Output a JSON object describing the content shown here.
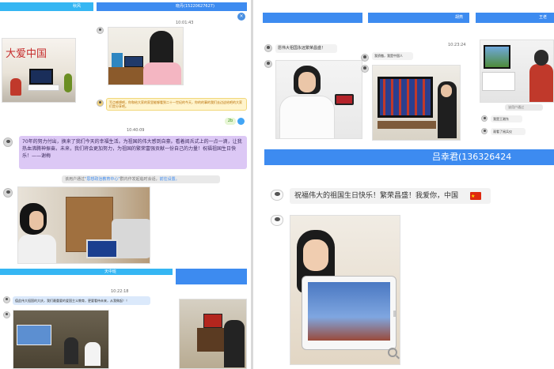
{
  "left_panel": {
    "top_bar_1": {
      "text": "秋风"
    },
    "top_bar_2": {
      "text": "晓丹(15220627627)"
    },
    "time_1": "10:01:43",
    "time_2": "10:40:09",
    "time_3": "10:22:18",
    "calligraphy_text": "大爱中国",
    "tip_bubble": "写点感想吧，你和给大家的家里能够看到二十一世纪的今天，你的的事的我们去边这给吧的大家们是分享吧。",
    "badge_count": "2b",
    "purple_message": "70年的努力付出，换来了我们今天的幸福生活。为祖国的伟大感到自豪。看着阅兵式上的一点一滴，让我热血沸腾神振奋。未来，我们将会更加努力，为祖国的繁荣富强贡献一份自己的力量！祝福祖国生日快乐！——谢梅",
    "notice_1": {
      "prefix": "该用户通过",
      "link1": "\"思想政治教育中心\"",
      "middle": "群内作发起临时会话，",
      "link2": "前往设置。"
    },
    "bar_3": {
      "text": "天中班"
    },
    "bottom_message": "值此伟大祖国的大庆，我们最重要的爱国主义教育，更要看待未来，从我做起！！"
  },
  "right_panel": {
    "top_bar_1": {
      "text": ""
    },
    "top_bar_2": {
      "text": "胡燕"
    },
    "top_bar_3": {
      "text": "王老"
    },
    "msg_1": "愿伟大祖国永远繁荣昌盛！",
    "msg_2": "我骄傲，我是中国人",
    "time_1": "10:23:24",
    "notice_small": "该用户通过",
    "msg_3": "我是王湘东",
    "msg_4": "观看了阅兵仪",
    "name_bar": {
      "text": "吕幸君(136326424"
    },
    "big_message": "祝福伟大的祖国生日快乐！繁荣昌盛！我爱你，中国",
    "flag_icon": "china-flag-icon",
    "zoom_icon": "zoom-icon"
  },
  "colors": {
    "primary_blue": "#3d8bf0",
    "light_blue": "#35b6f3",
    "purple": "#dcc8f5",
    "tip_yellow": "#fff4cc"
  }
}
